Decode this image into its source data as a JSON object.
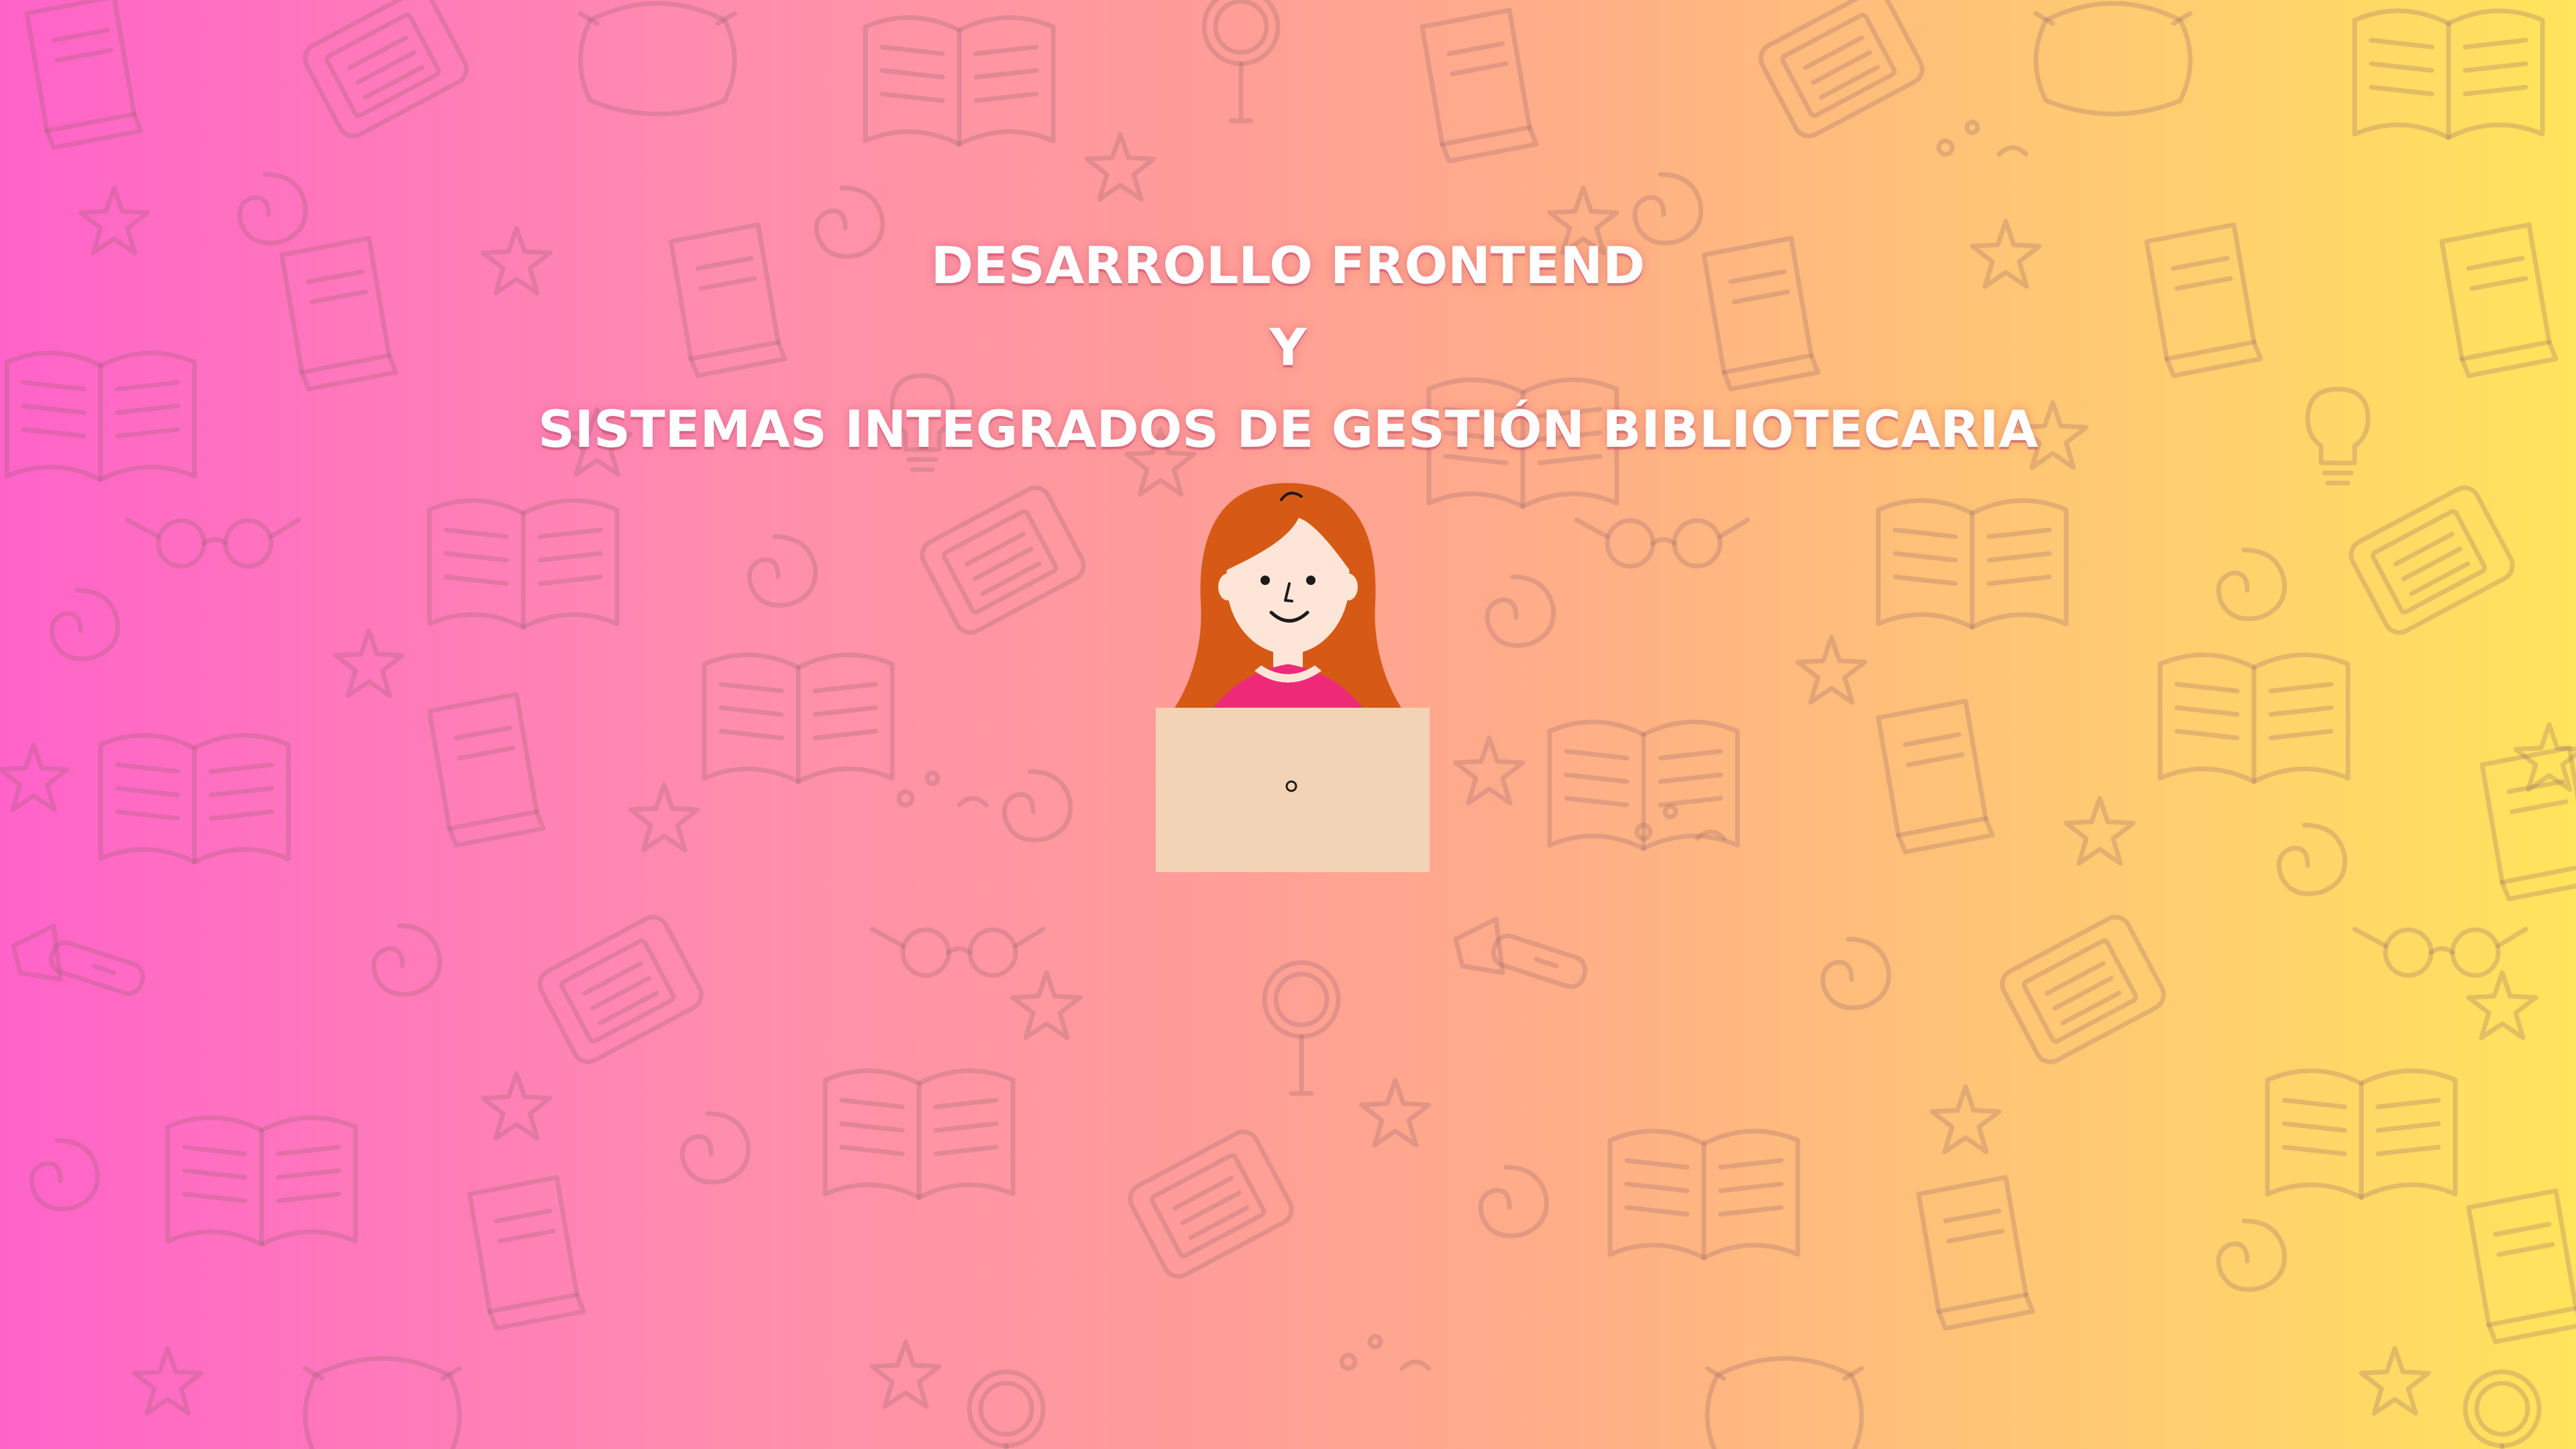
{
  "banner": {
    "title_line_1": "DESARROLLO FRONTEND",
    "title_line_2": "Y",
    "title_line_3": "SISTEMAS INTEGRADOS DE GESTIÓN BIBLIOTECARIA",
    "background_icons": [
      "book-icon",
      "open-book-icon",
      "tablet-icon",
      "star-icon",
      "swirl-icon",
      "magnifier-icon",
      "glasses-icon",
      "lightbulb-icon",
      "flashlight-icon"
    ]
  },
  "colors": {
    "gradient_left": "#ff63c9",
    "gradient_right": "#ffe45c",
    "title_text": "#ffffff",
    "hair": "#d65a16",
    "shirt": "#ee2a78",
    "laptop": "#f3d3b6",
    "skin": "#fde6d8"
  }
}
